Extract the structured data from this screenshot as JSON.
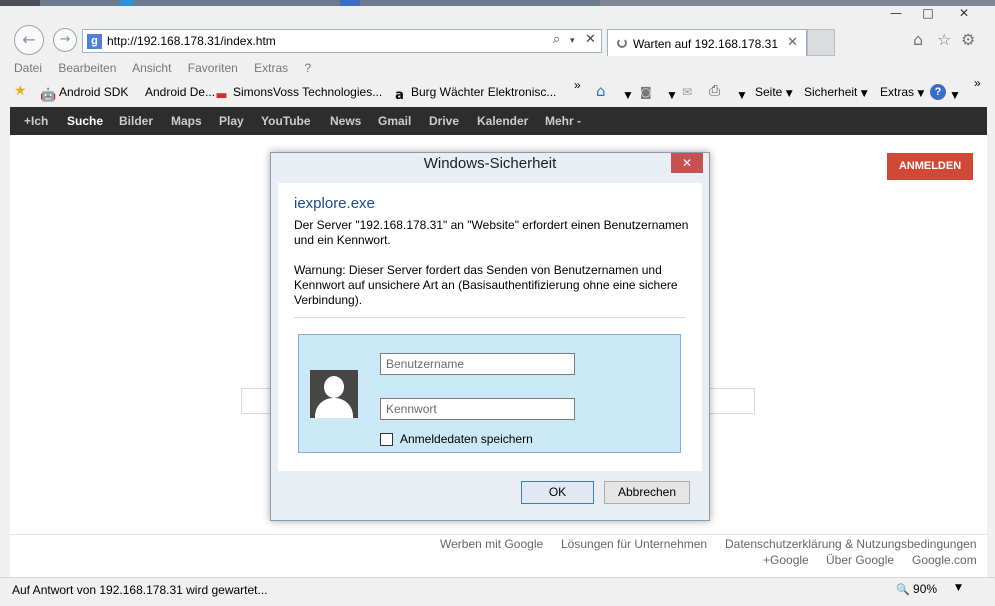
{
  "window": {
    "minimize_glyph": "—",
    "maximize_glyph": "□",
    "close_glyph": "✕"
  },
  "nav": {
    "back_glyph": "←",
    "forward_glyph": "→",
    "address_url": "http://192.168.178.31/index.htm",
    "favicon_letter": "g",
    "tab_title": "Warten auf 192.168.178.31",
    "tab_close": "✕",
    "search_glyph": "⌕",
    "dropdown_glyph": "▾",
    "stop_glyph": "✕",
    "home_glyph": "⌂",
    "star_glyph": "☆",
    "gear_glyph": "⚙"
  },
  "menubar": [
    "Datei",
    "Bearbeiten",
    "Ansicht",
    "Favoriten",
    "Extras",
    "?"
  ],
  "favorites": {
    "add_glyph": "★",
    "items": [
      {
        "label": "Android SDK",
        "icon": "android-icon",
        "glyph": "🤖"
      },
      {
        "label": "Android De...",
        "icon": "android-icon",
        "glyph": "🤖"
      },
      {
        "label": "SimonsVoss Technologies...",
        "icon": "simonsvoss-icon",
        "glyph": "▬"
      },
      {
        "label": "Burg Wächter Elektronisc...",
        "icon": "amazon-icon",
        "glyph": "a"
      }
    ],
    "overflow": "»",
    "toolbar": {
      "home_glyph": "⌂",
      "feeds_glyph": "◙",
      "mail_glyph": "✉",
      "print_glyph": "⎙",
      "page": "Seite",
      "safety": "Sicherheit",
      "tools": "Extras",
      "help_glyph": "?",
      "overflow2": "»",
      "arrow": "▼"
    }
  },
  "google_bar": [
    "+Ich",
    "Suche",
    "Bilder",
    "Maps",
    "Play",
    "YouTube",
    "News",
    "Gmail",
    "Drive",
    "Kalender",
    "Mehr -"
  ],
  "page": {
    "signin": "ANMELDEN",
    "footer_links": [
      "Werben mit Google",
      "Lösungen für Unternehmen",
      "Datenschutzerklärung & Nutzungsbedingungen"
    ],
    "footer_links2": [
      "+Google",
      "Über Google",
      "Google.com"
    ]
  },
  "dialog": {
    "title": "Windows-Sicherheit",
    "close_glyph": "✕",
    "app": "iexplore.exe",
    "message": "Der Server \"192.168.178.31\" an \"Website\" erfordert einen Benutzernamen und ein Kennwort.",
    "warning": "Warnung: Dieser Server fordert das Senden von Benutzernamen und Kennwort auf unsichere Art an (Basisauthentifizierung ohne eine sichere Verbindung).",
    "username_placeholder": "Benutzername",
    "password_placeholder": "Kennwort",
    "remember_label": "Anmeldedaten speichern",
    "ok": "OK",
    "cancel": "Abbrechen"
  },
  "status": {
    "text": "Auf Antwort von 192.168.178.31 wird gewartet...",
    "zoom": "90%",
    "zoom_glyph": "🔍",
    "arrow": "▼"
  },
  "colors": {
    "google_bar": "#2d2d2d",
    "signin_button": "#d14836",
    "dialog_close": "#c75050",
    "credential_panel": "#cbe8f6"
  }
}
